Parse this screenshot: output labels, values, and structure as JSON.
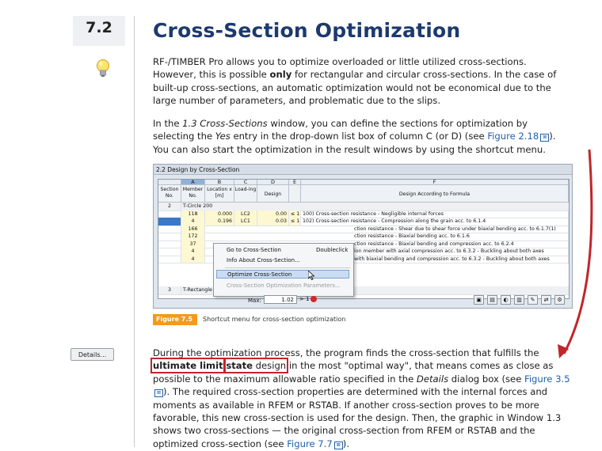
{
  "section": {
    "number": "7.2",
    "title": "Cross-Section Optimization"
  },
  "paragraph1": {
    "a": "RF-/TIMBER Pro allows you to optimize overloaded or little utilized cross-sections. However, this is possible ",
    "b": "only",
    "c": " for rectangular and circular cross-sections. In the case of built-up cross-sections, an automatic optimization would not be economical due to the large number of parameters, and problematic due to the slips."
  },
  "paragraph2": {
    "a": "In the ",
    "b": "1.3 Cross-Sections",
    "c": " window, you can define the sections for optimization by selecting the ",
    "d": "Yes",
    "e": " entry in the drop-down list box of column C (or D) (see ",
    "link": "Figure 2.18",
    "f": "). You can also start the optimization in the result windows by using the shortcut menu."
  },
  "screenshot": {
    "window_title": "2.2 Design by Cross-Section",
    "columns": [
      "A",
      "B",
      "C",
      "D",
      "E",
      "F"
    ],
    "headers": {
      "section": "Section No.",
      "member": "Member No.",
      "location": "Location x [m]",
      "loading": "Load-ing",
      "design": "Design",
      "formula": "Design According to Formula"
    },
    "group1": {
      "no": "2",
      "name": "T-Circle 200"
    },
    "rows": [
      {
        "member": "118",
        "loc": "0.000",
        "load": "LC2",
        "design": "0.00",
        "le": "≤ 1",
        "formula": "100) Cross-section resistance - Negligible internal forces"
      },
      {
        "member": "4",
        "loc": "0.196",
        "load": "LC1",
        "design": "0.03",
        "le": "≤ 1",
        "formula": "102) Cross-section resistance - Compression along the grain acc. to 6.1.4"
      },
      {
        "member": "166",
        "loc": "",
        "load": "",
        "design": "",
        "le": "",
        "formula": "ction resistance - Shear due to shear force under biaxial bending acc. to 6.1.7(1)"
      },
      {
        "member": "172",
        "loc": "",
        "load": "",
        "design": "",
        "le": "",
        "formula": "ction resistance - Biaxial bending acc. to 6.1.6"
      },
      {
        "member": "37",
        "loc": "",
        "load": "",
        "design": "",
        "le": "",
        "formula": "ction resistance - Biaxial bending and compression acc. to 6.2.4"
      },
      {
        "member": "4",
        "loc": "",
        "load": "",
        "design": "",
        "le": "",
        "formula": "ion member with axial compression acc. to 6.3.2 - Buckling about both axes"
      },
      {
        "member": "4",
        "loc": "",
        "load": "",
        "design": "",
        "le": "",
        "formula": "with biaxial bending and compression acc. to 6.3.2 - Buckling about both axes"
      }
    ],
    "group2": {
      "no": "3",
      "name": "T-Rectangle 80/220"
    },
    "context_menu": {
      "items": [
        {
          "label": "Go to Cross-Section",
          "shortcut": "Doubleclick"
        },
        {
          "label": "Info About Cross-Section...",
          "shortcut": ""
        },
        {
          "label": "Optimize Cross-Section",
          "shortcut": ""
        },
        {
          "label": "Cross-Section Optimization Parameters...",
          "shortcut": ""
        }
      ]
    },
    "max_label": "Max:",
    "max_value": "1.02",
    "max_cond": "> 1"
  },
  "figure": {
    "tag": "Figure 7.5",
    "caption": "Shortcut menu for cross-section optimization"
  },
  "details_button": "Details...",
  "paragraph3": {
    "a": "During the optimization process, the program finds the cross-section that fulfills the ",
    "b1": "ultimate limit",
    "b2": "state",
    "c": " design",
    "d": " in the most \"optimal way\", that means comes as close as possible to the maximum allowable ratio specified in the ",
    "e": "Details",
    "f": " dialog box (see ",
    "link1": "Figure 3.5",
    "g": "). The required cross-section properties are determined with the internal forces and moments as available in RFEM or RSTAB. If another cross-section proves to be more favorable, this new cross-section is used for the design. Then, the graphic in Window 1.3 shows two cross-sections — the original cross-section from RFEM or RSTAB and the optimized cross-section (see ",
    "link2": "Figure 7.7",
    "h": ")."
  },
  "colors": {
    "title": "#1c3a6e",
    "link": "#1f5fae",
    "highlight": "#c0262b",
    "figure_tag": "#f39a1a"
  }
}
